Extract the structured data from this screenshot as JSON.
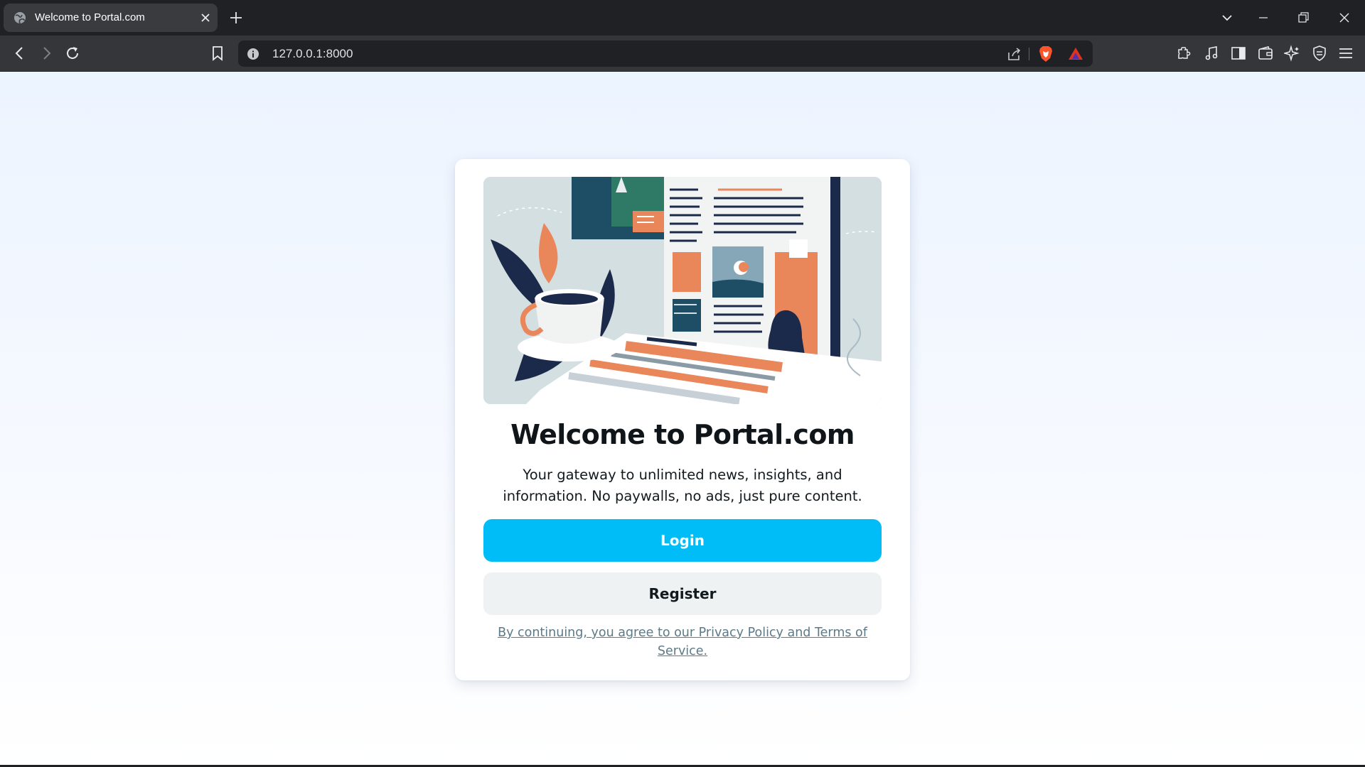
{
  "browser": {
    "tab": {
      "title": "Welcome to Portal.com",
      "favicon": "globe-icon"
    },
    "address_bar": {
      "url": "127.0.0.1:8000"
    },
    "icons": {
      "nav": [
        "back-icon",
        "forward-icon",
        "reload-icon",
        "bookmark-icon"
      ],
      "address": [
        "site-info-icon",
        "share-icon",
        "brave-shields-icon",
        "brave-rewards-icon"
      ],
      "extensions": [
        "extensions-icon",
        "media-icon",
        "sidebar-icon",
        "wallet-icon",
        "leo-ai-icon",
        "vpn-icon",
        "menu-icon"
      ],
      "window": [
        "tab-search-icon",
        "minimize-icon",
        "restore-icon",
        "close-window-icon"
      ]
    }
  },
  "page": {
    "hero_image": "news-reading-illustration",
    "title": "Welcome to Portal.com",
    "subtitle": "Your gateway to unlimited news, insights, and information. No paywalls, no ads, just pure content.",
    "login_label": "Login",
    "register_label": "Register",
    "terms_text": "By continuing, you agree to our Privacy Policy and Terms of Service."
  },
  "colors": {
    "primary": "#00bdf8",
    "secondary": "#eff2f3",
    "terms_link": "#5c7a87",
    "chrome_dark": "#202124",
    "chrome_toolbar": "#35363a"
  }
}
